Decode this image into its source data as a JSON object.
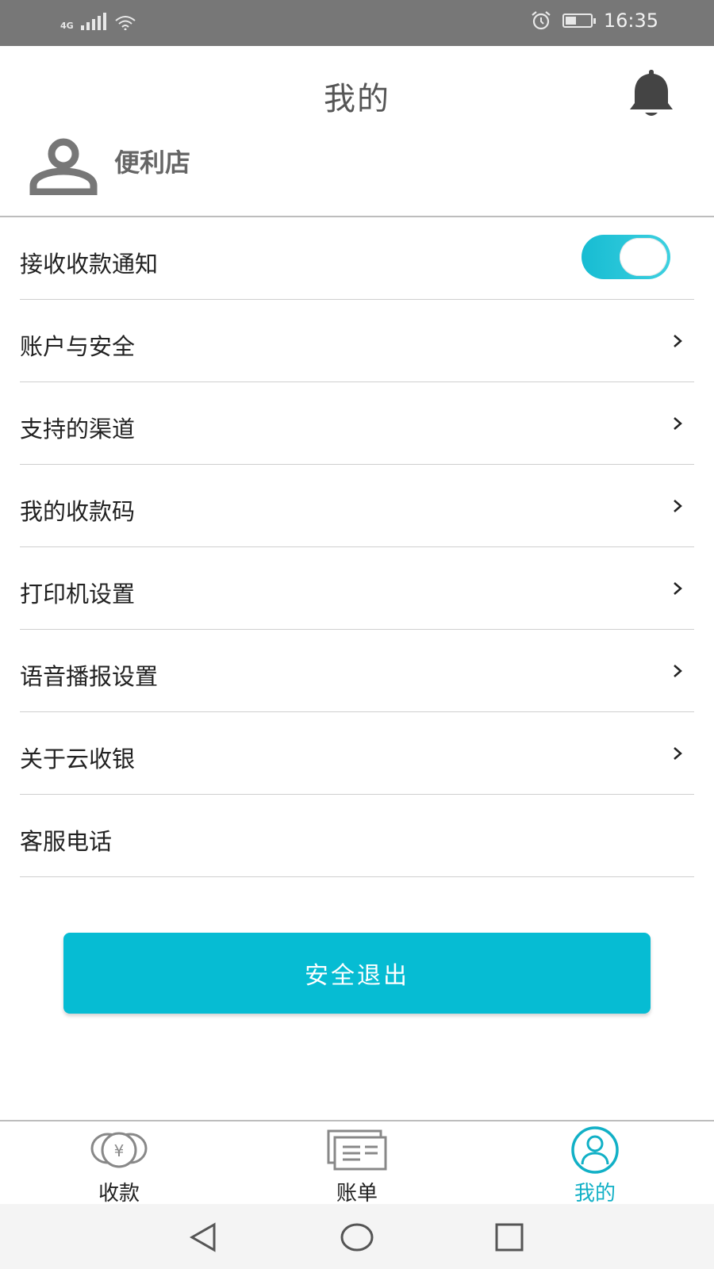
{
  "status_bar": {
    "network": "4G",
    "time": "16:35",
    "icons": [
      "signal-icon",
      "wifi-icon",
      "alarm-icon",
      "battery-icon"
    ]
  },
  "header": {
    "title": "我的",
    "bell_icon": "bell-icon"
  },
  "profile": {
    "name": "便利店",
    "avatar_icon": "user-icon"
  },
  "menu": {
    "items": [
      {
        "label": "接收收款通知",
        "control": "toggle",
        "on": true
      },
      {
        "label": "账户与安全",
        "control": "chevron"
      },
      {
        "label": "支持的渠道",
        "control": "chevron"
      },
      {
        "label": "我的收款码",
        "control": "chevron"
      },
      {
        "label": "打印机设置",
        "control": "chevron"
      },
      {
        "label": "语音播报设置",
        "control": "chevron"
      },
      {
        "label": "关于云收银",
        "control": "chevron"
      },
      {
        "label": "客服电话",
        "control": "none"
      }
    ]
  },
  "logout": {
    "label": "安全退出"
  },
  "bottom_nav": {
    "items": [
      {
        "label": "收款",
        "icon": "yuan-coin-icon",
        "active": false
      },
      {
        "label": "账单",
        "icon": "bill-icon",
        "active": false
      },
      {
        "label": "我的",
        "icon": "profile-icon",
        "active": true
      }
    ]
  },
  "colors": {
    "accent": "#06bcd3",
    "status_bar": "#777777",
    "active_tab": "#11b0c6"
  }
}
